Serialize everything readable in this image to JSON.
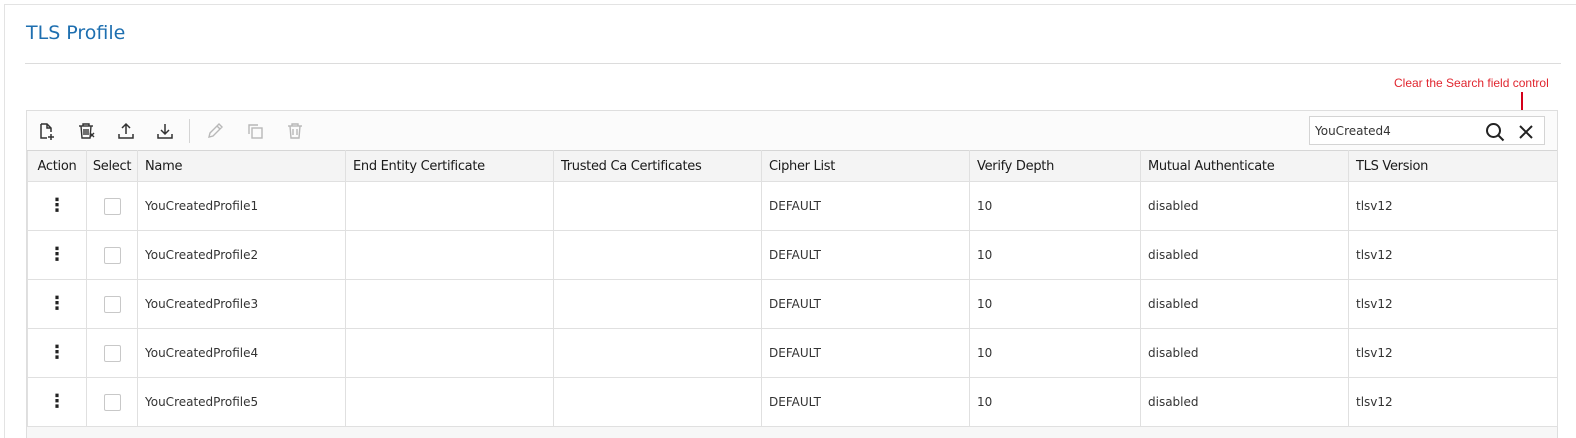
{
  "page": {
    "title": "TLS Profile"
  },
  "annotation": {
    "text": "Clear the Search field control"
  },
  "toolbar": {
    "buttons": [
      {
        "name": "create-icon",
        "enabled": true
      },
      {
        "name": "bulk-delete-icon",
        "enabled": true
      },
      {
        "name": "upload-icon",
        "enabled": true
      },
      {
        "name": "download-icon",
        "enabled": true
      },
      {
        "name": "edit-icon",
        "enabled": false
      },
      {
        "name": "clone-icon",
        "enabled": false
      },
      {
        "name": "delete-icon",
        "enabled": false
      }
    ]
  },
  "search": {
    "value": "YouCreated4",
    "placeholder": ""
  },
  "table": {
    "columns": [
      "Action",
      "Select",
      "Name",
      "End Entity Certificate",
      "Trusted Ca Certificates",
      "Cipher List",
      "Verify Depth",
      "Mutual Authenticate",
      "TLS Version"
    ],
    "rows": [
      {
        "action": "⋮",
        "name": "YouCreatedProfile1",
        "end_entity_certificate": "",
        "trusted_ca_certificates": "",
        "cipher_list": "DEFAULT",
        "verify_depth": "10",
        "mutual_authenticate": "disabled",
        "tls_version": "tlsv12"
      },
      {
        "action": "⋮",
        "name": "YouCreatedProfile2",
        "end_entity_certificate": "",
        "trusted_ca_certificates": "",
        "cipher_list": "DEFAULT",
        "verify_depth": "10",
        "mutual_authenticate": "disabled",
        "tls_version": "tlsv12"
      },
      {
        "action": "⋮",
        "name": "YouCreatedProfile3",
        "end_entity_certificate": "",
        "trusted_ca_certificates": "",
        "cipher_list": "DEFAULT",
        "verify_depth": "10",
        "mutual_authenticate": "disabled",
        "tls_version": "tlsv12"
      },
      {
        "action": "⋮",
        "name": "YouCreatedProfile4",
        "end_entity_certificate": "",
        "trusted_ca_certificates": "",
        "cipher_list": "DEFAULT",
        "verify_depth": "10",
        "mutual_authenticate": "disabled",
        "tls_version": "tlsv12"
      },
      {
        "action": "⋮",
        "name": "YouCreatedProfile5",
        "end_entity_certificate": "",
        "trusted_ca_certificates": "",
        "cipher_list": "DEFAULT",
        "verify_depth": "10",
        "mutual_authenticate": "disabled",
        "tls_version": "tlsv12"
      }
    ]
  },
  "colors": {
    "title": "#1e6fb0",
    "annotation": "#e0262f",
    "icon_enabled": "#333333",
    "icon_disabled": "#b8b8b8"
  }
}
